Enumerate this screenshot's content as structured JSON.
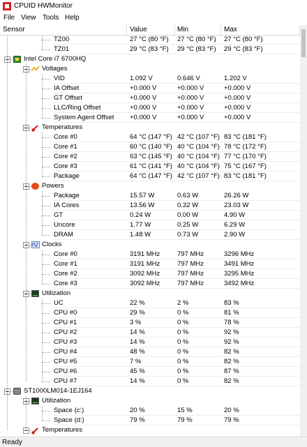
{
  "window": {
    "title": "CPUID HWMonitor"
  },
  "menu": [
    "File",
    "View",
    "Tools",
    "Help"
  ],
  "columns": {
    "sensor": "Sensor",
    "value": "Value",
    "min": "Min",
    "max": "Max"
  },
  "tree": [
    {
      "type": "sensor",
      "label": "TZ00",
      "value": "27 °C  (80 °F)",
      "min": "27 °C  (80 °F)",
      "max": "27 °C  (80 °F)",
      "level": 3
    },
    {
      "type": "sensor",
      "label": "TZ01",
      "value": "29 °C  (83 °F)",
      "min": "29 °C  (83 °F)",
      "max": "29 °C  (83 °F)",
      "level": 3
    },
    {
      "type": "device",
      "label": "Intel Core i7 6700HQ",
      "icon": "chip-icon",
      "level": 1
    },
    {
      "type": "group",
      "label": "Voltages",
      "icon": "voltage-icon",
      "level": 2
    },
    {
      "type": "sensor",
      "label": "VID",
      "value": "1.092 V",
      "min": "0.646 V",
      "max": "1.202 V",
      "level": 3
    },
    {
      "type": "sensor",
      "label": "IA Offset",
      "value": "+0.000 V",
      "min": "+0.000 V",
      "max": "+0.000 V",
      "level": 3
    },
    {
      "type": "sensor",
      "label": "GT Offset",
      "value": "+0.000 V",
      "min": "+0.000 V",
      "max": "+0.000 V",
      "level": 3
    },
    {
      "type": "sensor",
      "label": "LLC/Ring Offset",
      "value": "+0.000 V",
      "min": "+0.000 V",
      "max": "+0.000 V",
      "level": 3
    },
    {
      "type": "sensor",
      "label": "System Agent Offset",
      "value": "+0.000 V",
      "min": "+0.000 V",
      "max": "+0.000 V",
      "level": 3
    },
    {
      "type": "group",
      "label": "Temperatures",
      "icon": "thermometer-icon",
      "level": 2
    },
    {
      "type": "sensor",
      "label": "Core #0",
      "value": "64 °C  (147 °F)",
      "min": "42 °C  (107 °F)",
      "max": "83 °C  (181 °F)",
      "level": 3
    },
    {
      "type": "sensor",
      "label": "Core #1",
      "value": "60 °C  (140 °F)",
      "min": "40 °C  (104 °F)",
      "max": "78 °C  (172 °F)",
      "level": 3
    },
    {
      "type": "sensor",
      "label": "Core #2",
      "value": "63 °C  (145 °F)",
      "min": "40 °C  (104 °F)",
      "max": "77 °C  (170 °F)",
      "level": 3
    },
    {
      "type": "sensor",
      "label": "Core #3",
      "value": "61 °C  (141 °F)",
      "min": "40 °C  (104 °F)",
      "max": "75 °C  (167 °F)",
      "level": 3
    },
    {
      "type": "sensor",
      "label": "Package",
      "value": "64 °C  (147 °F)",
      "min": "42 °C  (107 °F)",
      "max": "83 °C  (181 °F)",
      "level": 3
    },
    {
      "type": "group",
      "label": "Powers",
      "icon": "power-icon",
      "level": 2
    },
    {
      "type": "sensor",
      "label": "Package",
      "value": "15.57 W",
      "min": "0.63 W",
      "max": "26.26 W",
      "level": 3
    },
    {
      "type": "sensor",
      "label": "IA Cores",
      "value": "13.56 W",
      "min": "0.32 W",
      "max": "23.03 W",
      "level": 3
    },
    {
      "type": "sensor",
      "label": "GT",
      "value": "0.24 W",
      "min": "0.00 W",
      "max": "4.90 W",
      "level": 3
    },
    {
      "type": "sensor",
      "label": "Uncore",
      "value": "1.77 W",
      "min": "0.25 W",
      "max": "6.29 W",
      "level": 3
    },
    {
      "type": "sensor",
      "label": "DRAM",
      "value": "1.48 W",
      "min": "0.73 W",
      "max": "2.90 W",
      "level": 3
    },
    {
      "type": "group",
      "label": "Clocks",
      "icon": "clock-icon",
      "level": 2
    },
    {
      "type": "sensor",
      "label": "Core #0",
      "value": "3191 MHz",
      "min": "797 MHz",
      "max": "3296 MHz",
      "level": 3
    },
    {
      "type": "sensor",
      "label": "Core #1",
      "value": "3191 MHz",
      "min": "797 MHz",
      "max": "3491 MHz",
      "level": 3
    },
    {
      "type": "sensor",
      "label": "Core #2",
      "value": "3092 MHz",
      "min": "797 MHz",
      "max": "3295 MHz",
      "level": 3
    },
    {
      "type": "sensor",
      "label": "Core #3",
      "value": "3092 MHz",
      "min": "797 MHz",
      "max": "3492 MHz",
      "level": 3
    },
    {
      "type": "group",
      "label": "Utilization",
      "icon": "utilization-icon",
      "level": 2
    },
    {
      "type": "sensor",
      "label": "UC",
      "value": "22 %",
      "min": "2 %",
      "max": "83 %",
      "level": 3
    },
    {
      "type": "sensor",
      "label": "CPU #0",
      "value": "29 %",
      "min": "0 %",
      "max": "81 %",
      "level": 3
    },
    {
      "type": "sensor",
      "label": "CPU #1",
      "value": "3 %",
      "min": "0 %",
      "max": "78 %",
      "level": 3
    },
    {
      "type": "sensor",
      "label": "CPU #2",
      "value": "14 %",
      "min": "0 %",
      "max": "92 %",
      "level": 3
    },
    {
      "type": "sensor",
      "label": "CPU #3",
      "value": "14 %",
      "min": "0 %",
      "max": "92 %",
      "level": 3
    },
    {
      "type": "sensor",
      "label": "CPU #4",
      "value": "48 %",
      "min": "0 %",
      "max": "82 %",
      "level": 3
    },
    {
      "type": "sensor",
      "label": "CPU #5",
      "value": "7 %",
      "min": "0 %",
      "max": "82 %",
      "level": 3
    },
    {
      "type": "sensor",
      "label": "CPU #6",
      "value": "45 %",
      "min": "0 %",
      "max": "87 %",
      "level": 3
    },
    {
      "type": "sensor",
      "label": "CPU #7",
      "value": "14 %",
      "min": "0 %",
      "max": "82 %",
      "level": 3
    },
    {
      "type": "device",
      "label": "ST1000LM014-1EJ164",
      "icon": "hard-drive-icon",
      "level": 1
    },
    {
      "type": "group",
      "label": "Utilization",
      "icon": "utilization-icon",
      "level": 2
    },
    {
      "type": "sensor",
      "label": "Space (c:)",
      "value": "20 %",
      "min": "15 %",
      "max": "20 %",
      "level": 3
    },
    {
      "type": "sensor",
      "label": "Space (d:)",
      "value": "79 %",
      "min": "79 %",
      "max": "79 %",
      "level": 3
    },
    {
      "type": "group",
      "label": "Temperatures",
      "icon": "thermometer-icon",
      "level": 2
    }
  ],
  "status": {
    "text": "Ready"
  }
}
